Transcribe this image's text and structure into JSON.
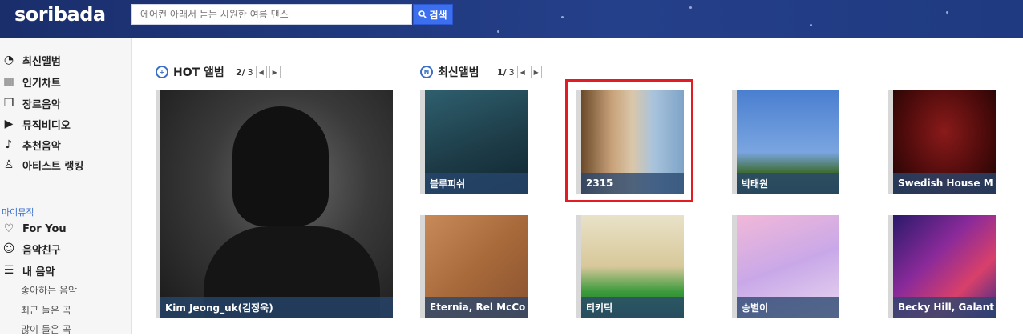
{
  "brand": {
    "logo": "soribada"
  },
  "search": {
    "placeholder": "에어컨 아래서 듣는 시원한 여름 댄스",
    "button_label": "검색"
  },
  "sidebar": {
    "main_items": [
      {
        "label": "최신앨범",
        "icon": "new-album-icon"
      },
      {
        "label": "인기차트",
        "icon": "chart-icon"
      },
      {
        "label": "장르음악",
        "icon": "genre-icon"
      },
      {
        "label": "뮤직비디오",
        "icon": "video-icon"
      },
      {
        "label": "추천음악",
        "icon": "music-note-icon"
      },
      {
        "label": "아티스트 랭킹",
        "icon": "artist-icon"
      }
    ],
    "my_music_title": "마이뮤직",
    "my_items": [
      {
        "label": "For You",
        "icon": "heart-icon"
      },
      {
        "label": "음악친구",
        "icon": "friends-icon"
      },
      {
        "label": "내 음악",
        "icon": "playlist-icon"
      }
    ],
    "sub_items": [
      "좋아하는 음악",
      "최근 들은 곡",
      "많이 들은 곡"
    ]
  },
  "hot": {
    "title": "HOT 앨범",
    "page_current": "2/",
    "page_total": "3"
  },
  "new": {
    "title": "최신앨범",
    "page_current": "1/",
    "page_total": "3"
  },
  "hot_album": {
    "caption": "Kim Jeong_uk(김정욱)"
  },
  "new_albums": [
    {
      "caption": "블루피쉬"
    },
    {
      "caption": "2315"
    },
    {
      "caption": "박태원"
    },
    {
      "caption": "Swedish House M"
    },
    {
      "caption": "Eternia, Rel McCo"
    },
    {
      "caption": "티키틱"
    },
    {
      "caption": "송별이"
    },
    {
      "caption": "Becky Hill, Galant"
    }
  ],
  "colors": {
    "header": "#1f3a80",
    "accent": "#3c6ef0",
    "highlight": "#e31b23"
  }
}
